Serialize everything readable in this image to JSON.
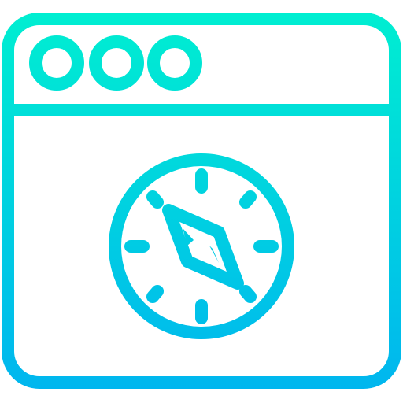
{
  "icon": {
    "name": "browser-compass-icon",
    "colors": {
      "gradient_top": "#00F0D0",
      "gradient_bottom": "#00B4F0"
    }
  }
}
